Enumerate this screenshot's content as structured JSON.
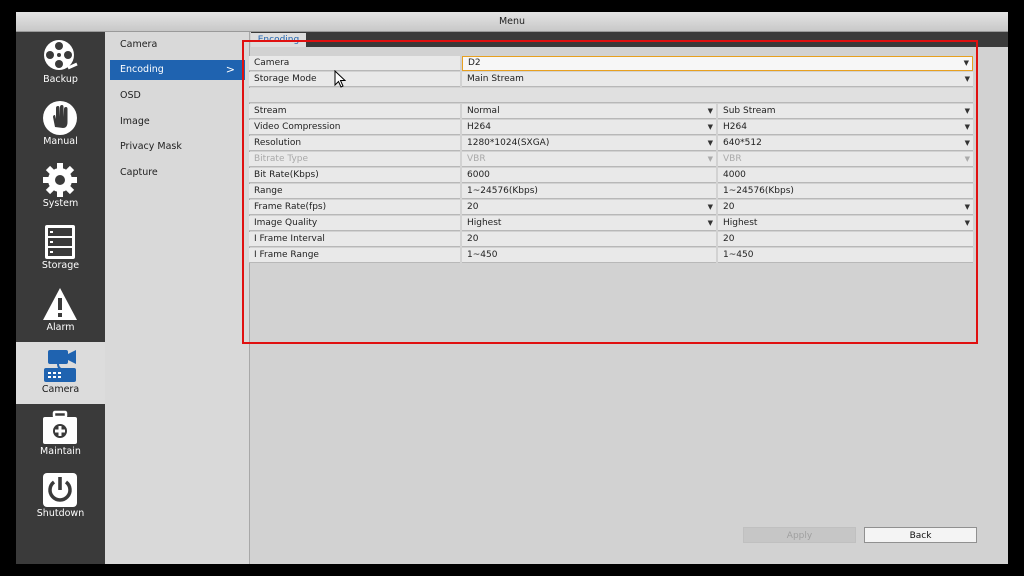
{
  "window": {
    "title": "Menu"
  },
  "nav": [
    {
      "label": "Backup",
      "icon": "film-reel-icon",
      "active": false
    },
    {
      "label": "Manual",
      "icon": "hand-icon",
      "active": false
    },
    {
      "label": "System",
      "icon": "gear-icon",
      "active": false
    },
    {
      "label": "Storage",
      "icon": "hard-drive-icon",
      "active": false
    },
    {
      "label": "Alarm",
      "icon": "warning-icon",
      "active": false
    },
    {
      "label": "Camera",
      "icon": "camera-icon",
      "active": true
    },
    {
      "label": "Maintain",
      "icon": "toolbox-icon",
      "active": false
    },
    {
      "label": "Shutdown",
      "icon": "power-icon",
      "active": false
    }
  ],
  "submenu": {
    "items": [
      "Camera",
      "Encoding",
      "OSD",
      "Image",
      "Privacy Mask",
      "Capture"
    ],
    "active_index": 1,
    "active_arrow": ">"
  },
  "tab": {
    "label": "Encoding"
  },
  "top_fields": {
    "camera": {
      "label": "Camera",
      "value": "D2"
    },
    "storage_mode": {
      "label": "Storage Mode",
      "value": "Main Stream"
    }
  },
  "table": {
    "rows": [
      {
        "label": "Stream",
        "main": "Normal",
        "sub": "Sub Stream",
        "dropdown": true
      },
      {
        "label": "Video Compression",
        "main": "H264",
        "sub": "H264",
        "dropdown": true
      },
      {
        "label": "Resolution",
        "main": "1280*1024(SXGA)",
        "sub": "640*512",
        "dropdown": true
      },
      {
        "label": "Bitrate Type",
        "main": "VBR",
        "sub": "VBR",
        "dropdown": true,
        "disabled": true
      },
      {
        "label": "Bit Rate(Kbps)",
        "main": "6000",
        "sub": "4000",
        "dropdown": false
      },
      {
        "label": "Range",
        "main": " 1~24576(Kbps)",
        "sub": " 1~24576(Kbps)",
        "dropdown": false
      },
      {
        "label": "Frame Rate(fps)",
        "main": "20",
        "sub": "20",
        "dropdown": true
      },
      {
        "label": "Image Quality",
        "main": "Highest",
        "sub": "Highest",
        "dropdown": true
      },
      {
        "label": "I Frame Interval",
        "main": "20",
        "sub": "20",
        "dropdown": false
      },
      {
        "label": "I Frame Range",
        "main": " 1~450",
        "sub": " 1~450",
        "dropdown": false
      }
    ]
  },
  "buttons": {
    "apply": "Apply",
    "back": "Back"
  },
  "colors": {
    "accent": "#1f63b0",
    "highlight_border": "#e01010",
    "focus_border": "#e7a020"
  }
}
